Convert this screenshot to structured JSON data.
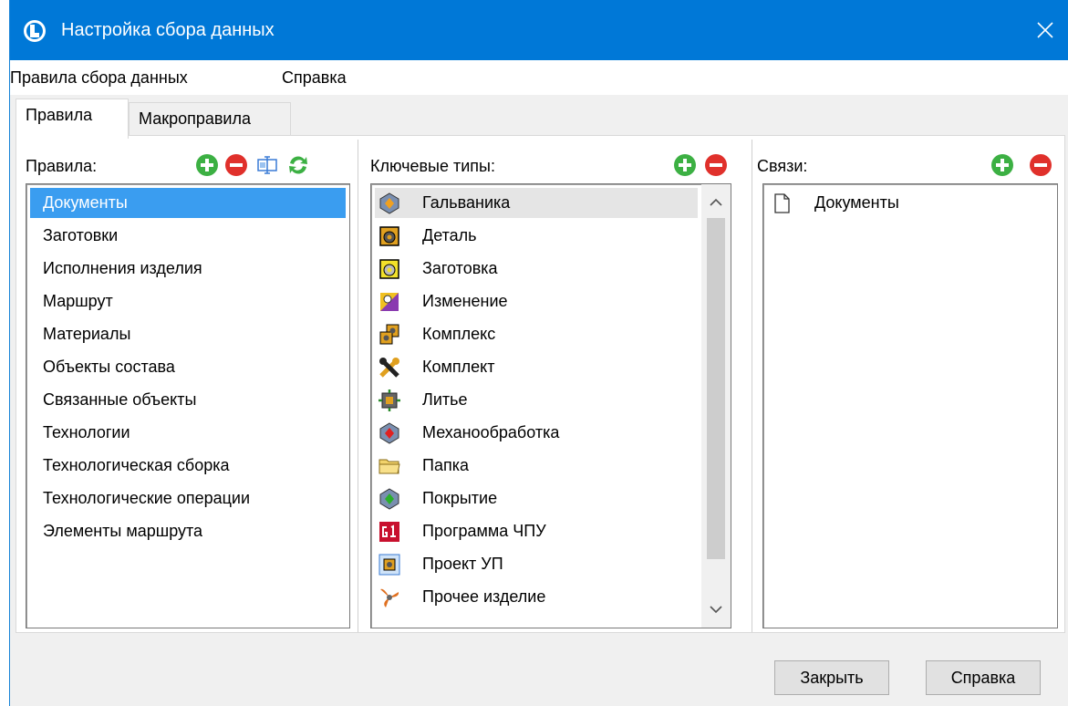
{
  "window": {
    "title": "Настройка сбора данных"
  },
  "menubar": {
    "items": [
      "Правила сбора данных",
      "Справка"
    ]
  },
  "tabs": [
    "Правила",
    "Макроправила"
  ],
  "rules_panel": {
    "header": "Правила:",
    "items": [
      "Документы",
      "Заготовки",
      "Исполнения изделия",
      "Маршрут",
      "Материалы",
      "Объекты состава",
      "Связанные объекты",
      "Технологии",
      "Технологическая сборка",
      "Технологические операции",
      "Элементы маршрута"
    ],
    "selected": "Документы"
  },
  "key_types_panel": {
    "header": "Ключевые типы:",
    "items": [
      {
        "label": "Гальваника",
        "icon": "galvanic-icon"
      },
      {
        "label": "Деталь",
        "icon": "detail-icon"
      },
      {
        "label": "Заготовка",
        "icon": "blank-icon"
      },
      {
        "label": "Изменение",
        "icon": "change-icon"
      },
      {
        "label": "Комплекс",
        "icon": "complex-icon"
      },
      {
        "label": "Комплект",
        "icon": "kit-icon"
      },
      {
        "label": "Литье",
        "icon": "casting-icon"
      },
      {
        "label": "Механообработка",
        "icon": "machining-icon"
      },
      {
        "label": "Папка",
        "icon": "folder-icon"
      },
      {
        "label": "Покрытие",
        "icon": "coating-icon"
      },
      {
        "label": "Программа ЧПУ",
        "icon": "cnc-program-icon"
      },
      {
        "label": "Проект УП",
        "icon": "cnc-project-icon"
      },
      {
        "label": "Прочее изделие",
        "icon": "other-product-icon"
      }
    ]
  },
  "links_panel": {
    "header": "Связи:",
    "items": [
      {
        "label": "Документы",
        "icon": "document-icon"
      }
    ]
  },
  "footer": {
    "close_label": "Закрыть",
    "help_label": "Справка"
  },
  "colors": {
    "titlebar": "#0078d7",
    "selection": "#3a9df0",
    "add": "#3cb043",
    "remove": "#e0302b"
  }
}
